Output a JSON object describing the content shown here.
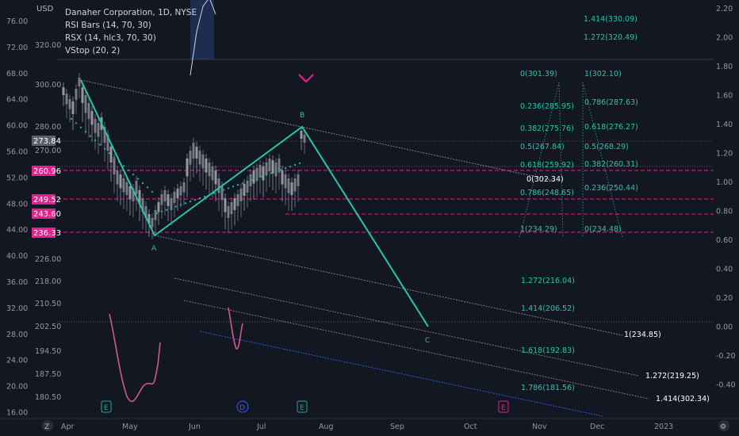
{
  "legend": {
    "title": "Danaher Corporation, 1D, NYSE",
    "line2": "RSI Bars (14, 70, 30)",
    "line3": "RSX (14, hlc3, 70, 30)",
    "line4": "VStop (20, 2)"
  },
  "currency": "USD",
  "left_axis_outer": [
    "76.00",
    "72.00",
    "68.00",
    "64.00",
    "60.00",
    "56.00",
    "52.00",
    "48.00",
    "44.00",
    "40.00",
    "36.00",
    "32.00",
    "28.00",
    "24.00",
    "20.00",
    "16.00"
  ],
  "left_axis_inner": [
    "320.00",
    "300.00",
    "280.00",
    "270.00",
    "226.00",
    "218.00",
    "210.50",
    "202.50",
    "194.50",
    "187.50",
    "180.50"
  ],
  "right_axis": [
    "2.20",
    "2.00",
    "1.80",
    "1.60",
    "1.40",
    "1.20",
    "1.00",
    "0.80",
    "0.60",
    "0.40",
    "0.20",
    "0.00",
    "-0.20",
    "-0.40"
  ],
  "x_axis": [
    "Apr",
    "May",
    "Jun",
    "Jul",
    "Aug",
    "Sep",
    "Oct",
    "Nov",
    "Dec",
    "2023"
  ],
  "price_tags": {
    "current": "273.84",
    "t1": "260.96",
    "t2": "249.52",
    "t3": "243.60",
    "t4": "236.33"
  },
  "wave_labels": {
    "a": "A",
    "b": "B",
    "c": "C"
  },
  "fib_left": [
    {
      "label": "0(301.39)"
    },
    {
      "label": "0.236(285.95)"
    },
    {
      "label": "0.382(275.76)"
    },
    {
      "label": "0.5(267.84)"
    },
    {
      "label": "0.618(259.92)"
    },
    {
      "label": "0.786(248.65)"
    },
    {
      "label": "1(234.29)"
    }
  ],
  "fib_right": [
    {
      "label": "1(302.10)"
    },
    {
      "label": "0.786(287.63)"
    },
    {
      "label": "0.618(276.27)"
    },
    {
      "label": "0.5(268.29)"
    },
    {
      "label": "0.382(260.31)"
    },
    {
      "label": "0.236(250.44)"
    },
    {
      "label": "0(234.48)"
    }
  ],
  "fib_ext_top": [
    "1.414(330.09)",
    "1.272(320.49)"
  ],
  "fib_ext_mid": [
    "1.272(216.04)",
    "1.414(206.52)",
    "1.618(192.83)",
    "1.786(181.56)"
  ],
  "channel_labels": [
    "0(302.34)",
    "1(234.85)",
    "1.272(219.25)",
    "1.414(302.34)"
  ],
  "event_markers": [
    "E",
    "D",
    "E",
    "E"
  ],
  "corner_buttons": {
    "left": "Z",
    "right": "⚙"
  },
  "colors": {
    "background": "#131722",
    "wave": "#26c6a6",
    "fib": "#26a69a",
    "magenta": "#e91e8c",
    "rsx": "#d05a7c",
    "text": "#d1d4dc",
    "axis_text": "#9598a1"
  }
}
